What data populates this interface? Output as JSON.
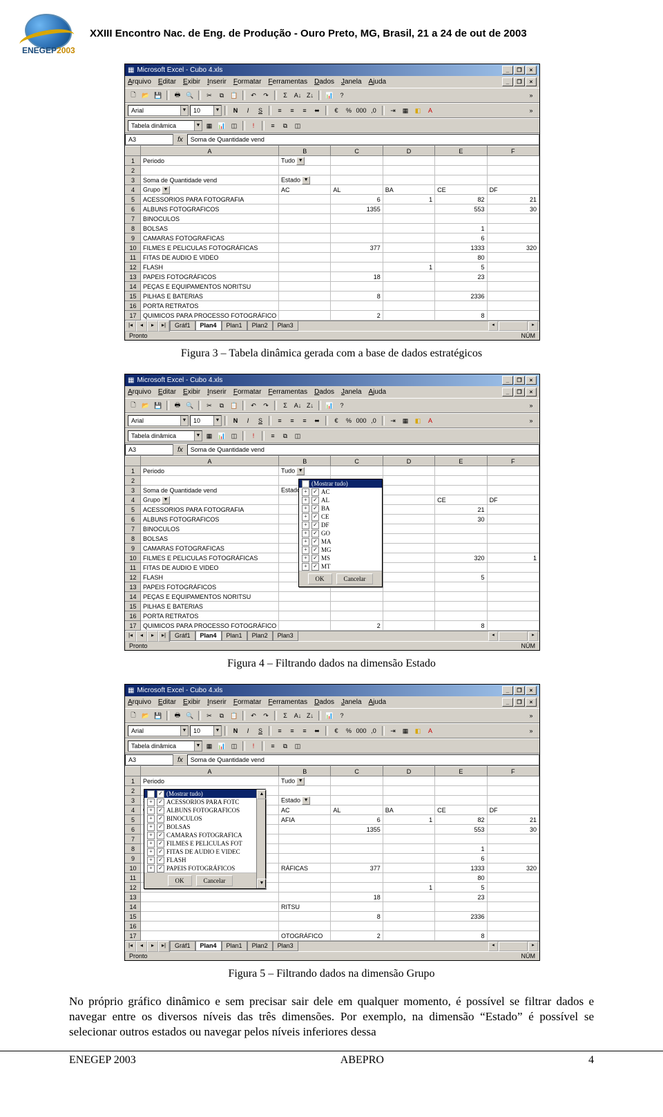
{
  "header": {
    "logo_main": "ENEGEP",
    "logo_year": "2003",
    "title": "XXIII Encontro Nac. de Eng. de Produção - Ouro Preto, MG, Brasil,  21 a 24  de out de 2003"
  },
  "excel_window": {
    "title": "Microsoft Excel - Cubo 4.xls",
    "menus": [
      "Arquivo",
      "Editar",
      "Exibir",
      "Inserir",
      "Formatar",
      "Ferramentas",
      "Dados",
      "Janela",
      "Ajuda"
    ],
    "font_name": "Arial",
    "font_size": "10",
    "pivot_toolbar_label": "Tabela dinâmica",
    "name_box": "A3",
    "formula": "Soma de Quantidade vend",
    "fx_label": "fx",
    "col_headers": [
      "A",
      "B",
      "C",
      "D",
      "E",
      "F"
    ],
    "sheet_tabs": [
      "Gráf1",
      "Plan4",
      "Plan1",
      "Plan2",
      "Plan3"
    ],
    "active_tab_index": 1,
    "status_left": "Pronto",
    "status_right": "NÚM"
  },
  "fig3": {
    "rows": [
      {
        "n": "1",
        "cells": [
          "Periodo",
          "Tudo",
          "",
          "",
          "",
          ""
        ],
        "drop": [
          1
        ]
      },
      {
        "n": "2",
        "cells": [
          "",
          "",
          "",
          "",
          "",
          ""
        ]
      },
      {
        "n": "3",
        "cells": [
          "Soma de Quantidade vend",
          "Estado",
          "",
          "",
          "",
          ""
        ],
        "drop": [
          1
        ]
      },
      {
        "n": "4",
        "cells": [
          "Grupo",
          "AC",
          "AL",
          "BA",
          "CE",
          "DF"
        ],
        "drop": [
          0
        ]
      },
      {
        "n": "5",
        "cells": [
          "ACESSORIOS PARA FOTOGRAFIA",
          "",
          "6",
          "1",
          "82",
          "21"
        ]
      },
      {
        "n": "6",
        "cells": [
          "ALBUNS FOTOGRAFICOS",
          "",
          "1355",
          "",
          "553",
          "30"
        ]
      },
      {
        "n": "7",
        "cells": [
          "BINOCULOS",
          "",
          "",
          "",
          "",
          ""
        ]
      },
      {
        "n": "8",
        "cells": [
          "BOLSAS",
          "",
          "",
          "",
          "1",
          ""
        ]
      },
      {
        "n": "9",
        "cells": [
          "CAMARAS FOTOGRAFICAS",
          "",
          "",
          "",
          "6",
          ""
        ]
      },
      {
        "n": "10",
        "cells": [
          "FILMES E PELICULAS FOTOGRÁFICAS",
          "",
          "377",
          "",
          "1333",
          "320"
        ]
      },
      {
        "n": "11",
        "cells": [
          "FITAS DE AUDIO E VIDEO",
          "",
          "",
          "",
          "80",
          ""
        ]
      },
      {
        "n": "12",
        "cells": [
          "FLASH",
          "",
          "",
          "1",
          "5",
          ""
        ]
      },
      {
        "n": "13",
        "cells": [
          "PAPEIS FOTOGRÁFICOS",
          "",
          "18",
          "",
          "23",
          ""
        ]
      },
      {
        "n": "14",
        "cells": [
          "PEÇAS E EQUIPAMENTOS NORITSU",
          "",
          "",
          "",
          "",
          ""
        ]
      },
      {
        "n": "15",
        "cells": [
          "PILHAS E BATERIAS",
          "",
          "8",
          "",
          "2336",
          ""
        ]
      },
      {
        "n": "16",
        "cells": [
          "PORTA RETRATOS",
          "",
          "",
          "",
          "",
          ""
        ]
      },
      {
        "n": "17",
        "cells": [
          "QUIMICOS PARA PROCESSO FOTOGRÁFICO",
          "",
          "2",
          "",
          "8",
          ""
        ]
      }
    ]
  },
  "fig4": {
    "rows": [
      {
        "n": "1",
        "cells": [
          "Periodo",
          "Tudo",
          "",
          "",
          "",
          ""
        ],
        "drop": [
          1
        ]
      },
      {
        "n": "2",
        "cells": [
          "",
          "",
          "",
          "",
          "",
          ""
        ]
      },
      {
        "n": "3",
        "cells": [
          "Soma de Quantidade vend",
          "Estado",
          "",
          "",
          "",
          ""
        ],
        "drop": [
          1
        ]
      },
      {
        "n": "4",
        "cells": [
          "Grupo",
          "",
          "",
          "",
          "CE",
          "DF"
        ],
        "drop": [
          0
        ]
      },
      {
        "n": "5",
        "cells": [
          "ACESSORIOS PARA FOTOGRAFIA",
          "",
          "",
          "",
          "21",
          ""
        ]
      },
      {
        "n": "6",
        "cells": [
          "ALBUNS FOTOGRAFICOS",
          "",
          "",
          "",
          "30",
          ""
        ]
      },
      {
        "n": "7",
        "cells": [
          "BINOCULOS",
          "",
          "",
          "",
          "",
          ""
        ]
      },
      {
        "n": "8",
        "cells": [
          "BOLSAS",
          "",
          "",
          "",
          "",
          ""
        ]
      },
      {
        "n": "9",
        "cells": [
          "CAMARAS FOTOGRAFICAS",
          "",
          "",
          "",
          "",
          ""
        ]
      },
      {
        "n": "10",
        "cells": [
          "FILMES E PELICULAS FOTOGRÁFICAS",
          "",
          "",
          "",
          "320",
          "1"
        ]
      },
      {
        "n": "11",
        "cells": [
          "FITAS DE AUDIO E VIDEO",
          "",
          "",
          "",
          "",
          ""
        ]
      },
      {
        "n": "12",
        "cells": [
          "FLASH",
          "",
          "",
          "",
          "5",
          ""
        ]
      },
      {
        "n": "13",
        "cells": [
          "PAPEIS FOTOGRÁFICOS",
          "",
          "",
          "",
          "",
          ""
        ]
      },
      {
        "n": "14",
        "cells": [
          "PEÇAS E EQUIPAMENTOS NORITSU",
          "",
          "",
          "",
          "",
          ""
        ]
      },
      {
        "n": "15",
        "cells": [
          "PILHAS E BATERIAS",
          "",
          "",
          "",
          "",
          ""
        ]
      },
      {
        "n": "16",
        "cells": [
          "PORTA RETRATOS",
          "",
          "",
          "",
          "",
          ""
        ]
      },
      {
        "n": "17",
        "cells": [
          "QUIMICOS PARA PROCESSO FOTOGRÁFICO",
          "",
          "2",
          "",
          "8",
          ""
        ]
      }
    ],
    "filter": {
      "show_all": "(Mostrar tudo)",
      "items": [
        "AC",
        "AL",
        "BA",
        "CE",
        "DF",
        "GO",
        "MA",
        "MG",
        "MS",
        "MT"
      ],
      "ok": "OK",
      "cancel": "Cancelar"
    }
  },
  "fig5": {
    "rows": [
      {
        "n": "1",
        "cells": [
          "Periodo",
          "Tudo",
          "",
          "",
          "",
          ""
        ],
        "drop": [
          1
        ]
      },
      {
        "n": "2",
        "cells": [
          "",
          "",
          "",
          "",
          "",
          ""
        ]
      },
      {
        "n": "3",
        "cells": [
          "Soma de Quantidade vend",
          "Estado",
          "",
          "",
          "",
          ""
        ],
        "drop": [
          1
        ]
      },
      {
        "n": "4",
        "cells": [
          "Grupo",
          "AC",
          "AL",
          "BA",
          "CE",
          "DF"
        ],
        "drop": [
          0
        ]
      },
      {
        "n": "5",
        "cells": [
          "",
          "AFIA",
          "6",
          "1",
          "82",
          "21"
        ]
      },
      {
        "n": "6",
        "cells": [
          "",
          "",
          "1355",
          "",
          "553",
          "30"
        ]
      },
      {
        "n": "7",
        "cells": [
          "",
          "",
          "",
          "",
          "",
          ""
        ]
      },
      {
        "n": "8",
        "cells": [
          "",
          "",
          "",
          "",
          "1",
          ""
        ]
      },
      {
        "n": "9",
        "cells": [
          "",
          "",
          "",
          "",
          "6",
          ""
        ]
      },
      {
        "n": "10",
        "cells": [
          "",
          "RÁFICAS",
          "377",
          "",
          "1333",
          "320"
        ]
      },
      {
        "n": "11",
        "cells": [
          "",
          "",
          "",
          "",
          "80",
          ""
        ]
      },
      {
        "n": "12",
        "cells": [
          "",
          "",
          "",
          "1",
          "5",
          ""
        ]
      },
      {
        "n": "13",
        "cells": [
          "",
          "",
          "18",
          "",
          "23",
          ""
        ]
      },
      {
        "n": "14",
        "cells": [
          "",
          "RITSU",
          "",
          "",
          "",
          ""
        ]
      },
      {
        "n": "15",
        "cells": [
          "",
          "",
          "8",
          "",
          "2336",
          ""
        ]
      },
      {
        "n": "16",
        "cells": [
          "",
          "",
          "",
          "",
          "",
          ""
        ]
      },
      {
        "n": "17",
        "cells": [
          "",
          "OTOGRÁFICO",
          "2",
          "",
          "8",
          ""
        ]
      }
    ],
    "filter": {
      "show_all": "(Mostrar tudo)",
      "items": [
        "ACESSORIOS PARA FOTC",
        "ALBUNS FOTOGRAFICOS",
        "BINOCULOS",
        "BOLSAS",
        "CAMARAS FOTOGRAFICA",
        "FILMES E PELICULAS FOT",
        "FITAS DE AUDIO E VIDEC",
        "FLASH",
        "PAPEIS FOTOGRÁFICOS"
      ],
      "ok": "OK",
      "cancel": "Cancelar"
    }
  },
  "captions": {
    "fig3": "Figura 3 – Tabela dinâmica gerada com a base de dados estratégicos",
    "fig4": "Figura 4 – Filtrando dados na dimensão Estado",
    "fig5": "Figura 5 – Filtrando dados na dimensão Grupo"
  },
  "body_text": "No próprio gráfico dinâmico e sem precisar sair dele em qualquer momento, é possível se filtrar dados e navegar entre os diversos níveis das três dimensões. Por exemplo, na dimensão “Estado” é possível se selecionar outros estados ou navegar pelos níveis inferiores dessa",
  "footer": {
    "left": "ENEGEP 2003",
    "center": "ABEPRO",
    "right": "4"
  },
  "icons": {
    "min": "_",
    "max": "❐",
    "close": "×",
    "dropdown": "▼"
  }
}
